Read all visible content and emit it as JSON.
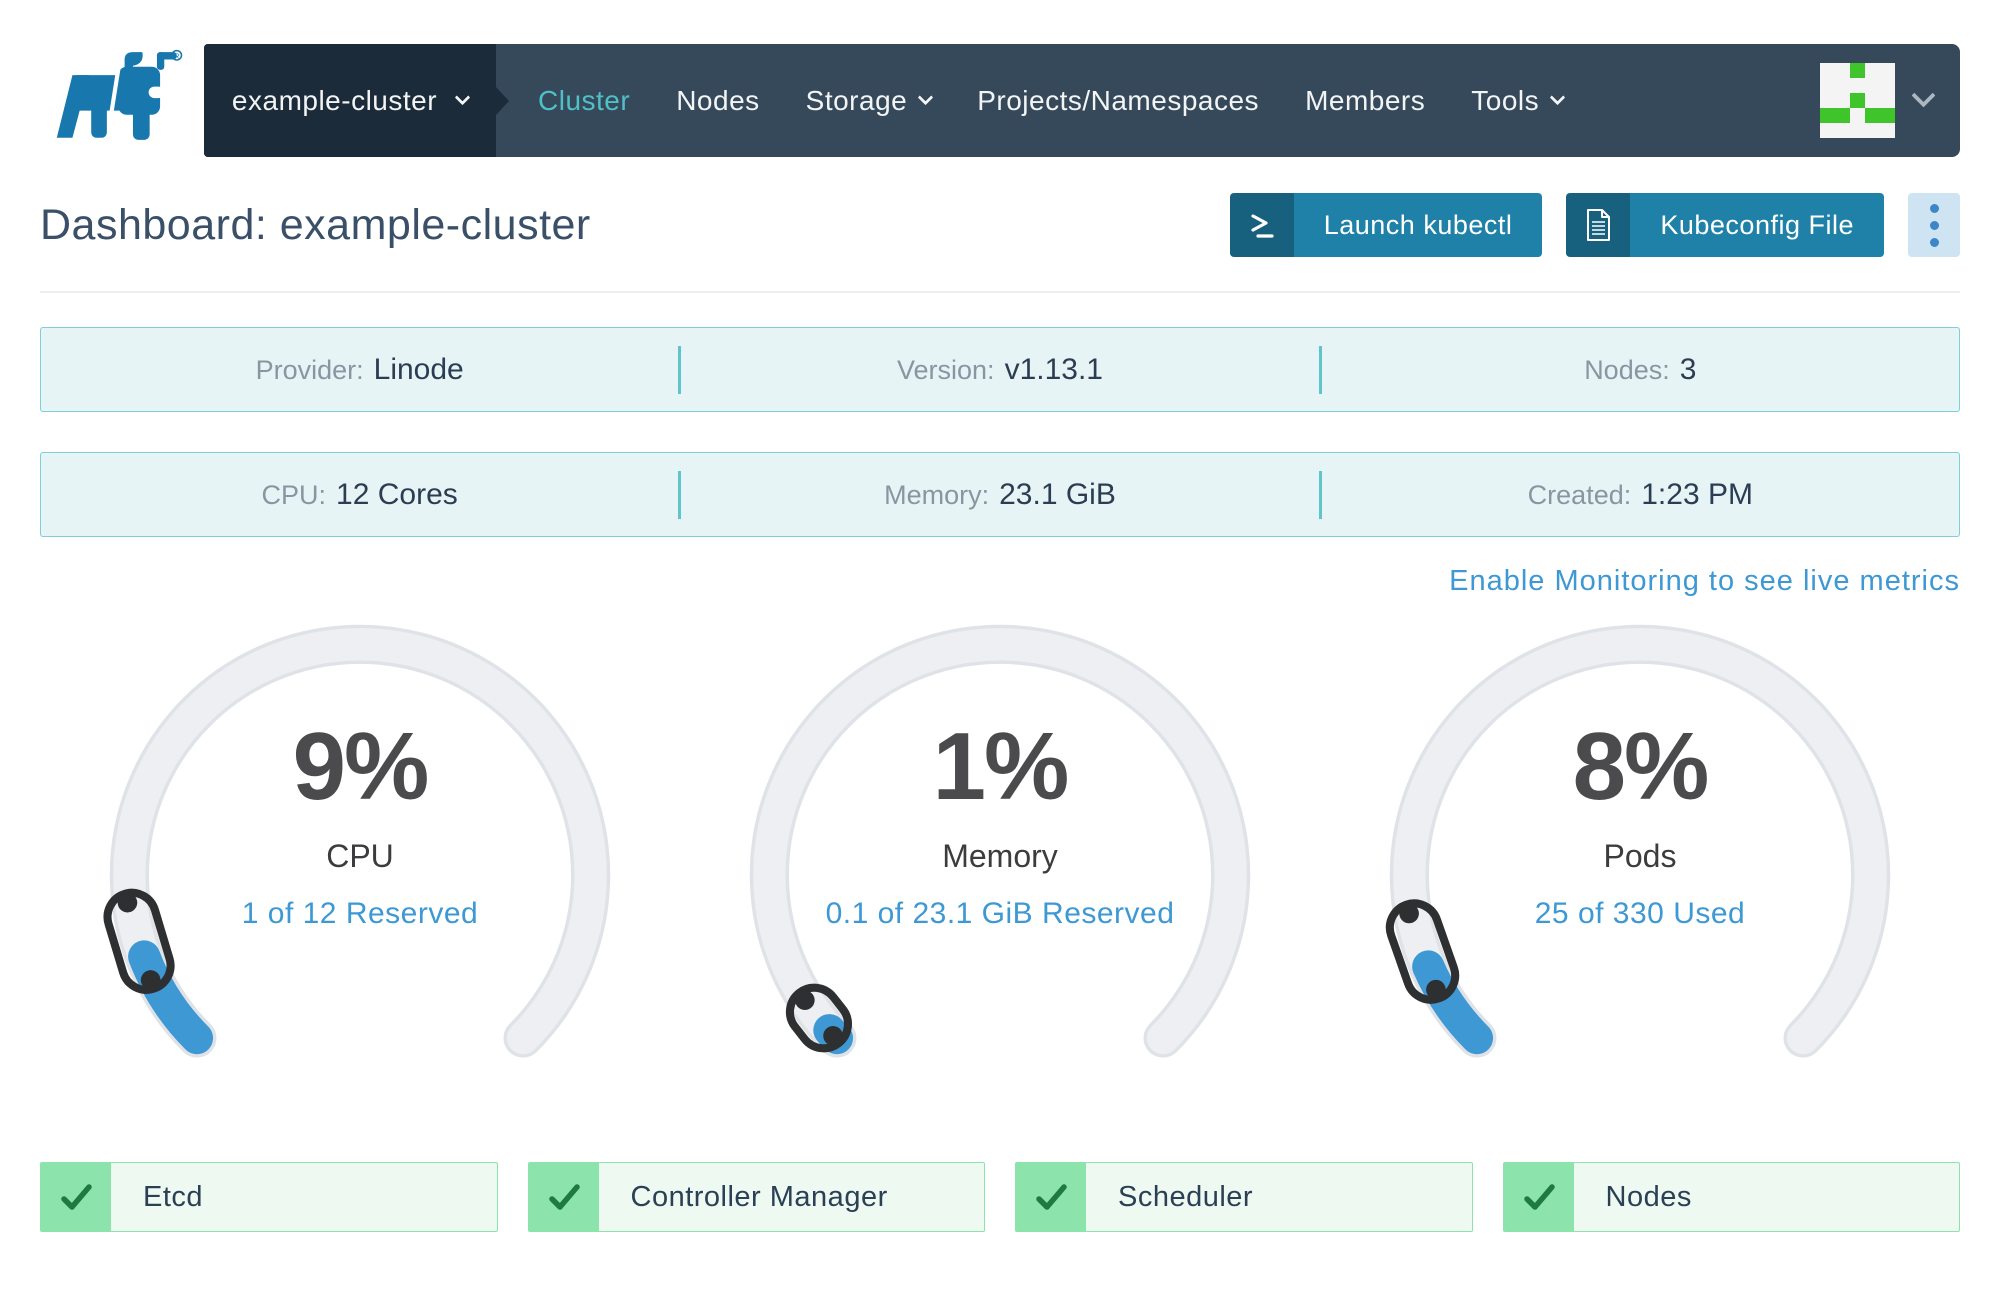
{
  "brand": {
    "name": "Rancher",
    "logo": "rancher-bull-logo"
  },
  "navbar": {
    "cluster_selector": {
      "label": "example-cluster"
    },
    "items": [
      {
        "label": "Cluster",
        "active": true,
        "dropdown": false
      },
      {
        "label": "Nodes",
        "active": false,
        "dropdown": false
      },
      {
        "label": "Storage",
        "active": false,
        "dropdown": true
      },
      {
        "label": "Projects/Namespaces",
        "active": false,
        "dropdown": false
      },
      {
        "label": "Members",
        "active": false,
        "dropdown": false
      },
      {
        "label": "Tools",
        "active": false,
        "dropdown": true
      }
    ],
    "user_menu": {
      "avatar": "identicon",
      "pattern": [
        "..X..",
        ".....",
        "..X..",
        "XX.XX",
        "....."
      ]
    }
  },
  "header": {
    "title": "Dashboard: example-cluster",
    "actions": [
      {
        "label": "Launch kubectl",
        "icon": "terminal-icon"
      },
      {
        "label": "Kubeconfig File",
        "icon": "file-icon"
      },
      {
        "label": "",
        "icon": "kebab-menu-icon"
      }
    ]
  },
  "info_rows": [
    {
      "cells": [
        {
          "label": "Provider:",
          "value": "Linode"
        },
        {
          "label": "Version:",
          "value": "v1.13.1"
        },
        {
          "label": "Nodes:",
          "value": "3"
        }
      ]
    },
    {
      "cells": [
        {
          "label": "CPU:",
          "value": "12 Cores"
        },
        {
          "label": "Memory:",
          "value": "23.1 GiB"
        },
        {
          "label": "Created:",
          "value": "1:23 PM"
        }
      ]
    }
  ],
  "monitoring": {
    "link_label": "Enable Monitoring to see live metrics"
  },
  "chart_data": [
    {
      "type": "gauge",
      "title": "CPU",
      "percent": 9,
      "percent_label": "9%",
      "subtitle": "1 of 12 Reserved",
      "used": 1,
      "total": 12,
      "range": [
        0,
        100
      ]
    },
    {
      "type": "gauge",
      "title": "Memory",
      "percent": 1,
      "percent_label": "1%",
      "subtitle": "0.1 of 23.1 GiB Reserved",
      "used": 0.1,
      "total": 23.1,
      "unit": "GiB",
      "range": [
        0,
        100
      ]
    },
    {
      "type": "gauge",
      "title": "Pods",
      "percent": 8,
      "percent_label": "8%",
      "subtitle": "25 of 330 Used",
      "used": 25,
      "total": 330,
      "range": [
        0,
        100
      ]
    }
  ],
  "component_statuses": [
    {
      "label": "Etcd",
      "state": "healthy"
    },
    {
      "label": "Controller Manager",
      "state": "healthy"
    },
    {
      "label": "Scheduler",
      "state": "healthy"
    },
    {
      "label": "Nodes",
      "state": "healthy"
    }
  ],
  "colors": {
    "navbar_bg": "#36495A",
    "navbar_dark": "#1C2B39",
    "accent_teal": "#4FC0C6",
    "button_blue": "#1F81A7",
    "button_icon_bg": "#17617F",
    "kebab_bg": "#CFE4F3",
    "link_blue": "#3D98D3",
    "gauge_track": "#EDEFF2",
    "gauge_fill": "#3D98D3",
    "gauge_handle": "#2E2F31",
    "info_bg": "#E7F4F6",
    "info_border": "#7FD0D6",
    "status_bg": "#EDF9F1",
    "status_accent": "#8CE3AB",
    "check_green": "#1E7A41",
    "text_dark": "#2B3D52",
    "label_gray": "#8B95A1",
    "brand_blue": "#1878AD",
    "identicon_green": "#3FC42C"
  }
}
